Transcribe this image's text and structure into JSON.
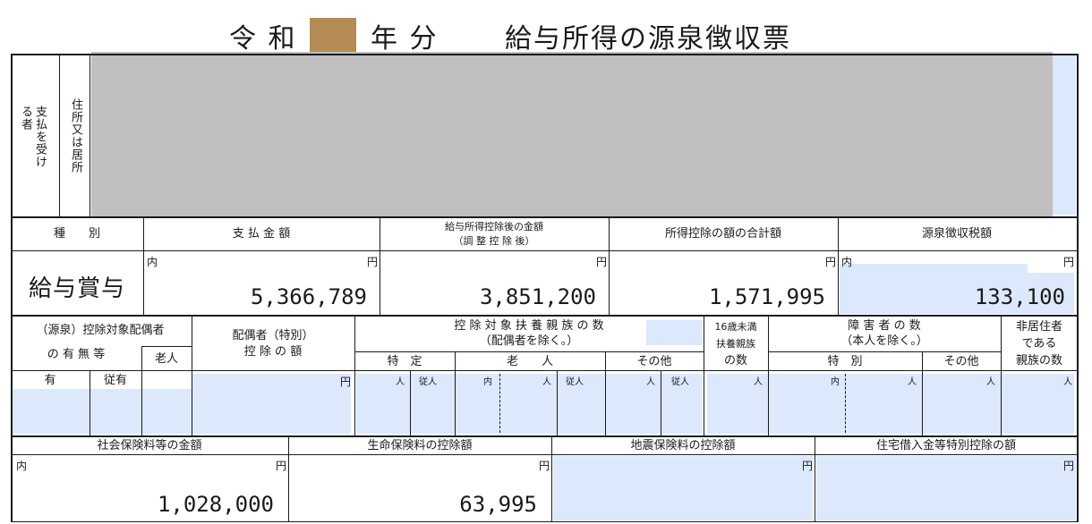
{
  "title": {
    "era": "令 和",
    "year_suffix": "年 分",
    "doc": "給与所得の源泉徴収票"
  },
  "recipient": {
    "side_label": "支払を受ける者",
    "address_label": "住所又は居所"
  },
  "row1": {
    "h_kind": "種　　別",
    "h_payment": "支 払 金 額",
    "h_after1": "給与所得控除後の金額",
    "h_after2": "（調 整 控 除 後）",
    "h_deduction": "所得控除の額の合計額",
    "h_tax": "源泉徴収税額",
    "kind": "給与賞与",
    "inner": "内",
    "yen": "円",
    "payment": "5,366,789",
    "after_deduction": "3,851,200",
    "deduction_total": "1,571,995",
    "tax": "133,100"
  },
  "row2": {
    "spouse1": "（源泉）控除対象配偶者",
    "spouse2": "の 有 無 等",
    "elder": "老人",
    "special1": "配偶者（特別）",
    "special2": "控 除 の 額",
    "dep1": "控 除 対 象 扶 養 親 族 の 数",
    "dep2": "（配偶者を除く。）",
    "tokutei": "特　定",
    "rojin": "老　　人",
    "sonota": "その他",
    "u16_1": "16歳未満",
    "u16_2": "扶養親族",
    "u16_3": "の数",
    "dis1": "障 害 者 の 数",
    "dis2": "（本人を除く。）",
    "dis_special": "特　別",
    "dis_other": "その他",
    "nonres1": "非居住者",
    "nonres2": "である",
    "nonres3": "親族の数",
    "yes": "有",
    "follower": "従有",
    "yen": "円",
    "person": "人",
    "follow_person": "従人",
    "inner": "内"
  },
  "row3": {
    "h_social": "社会保険料等の金額",
    "h_life": "生命保険料の控除額",
    "h_quake": "地震保険料の控除額",
    "h_housing": "住宅借入金等特別控除の額",
    "inner": "内",
    "yen": "円",
    "social": "1,028,000",
    "life": "63,995"
  }
}
